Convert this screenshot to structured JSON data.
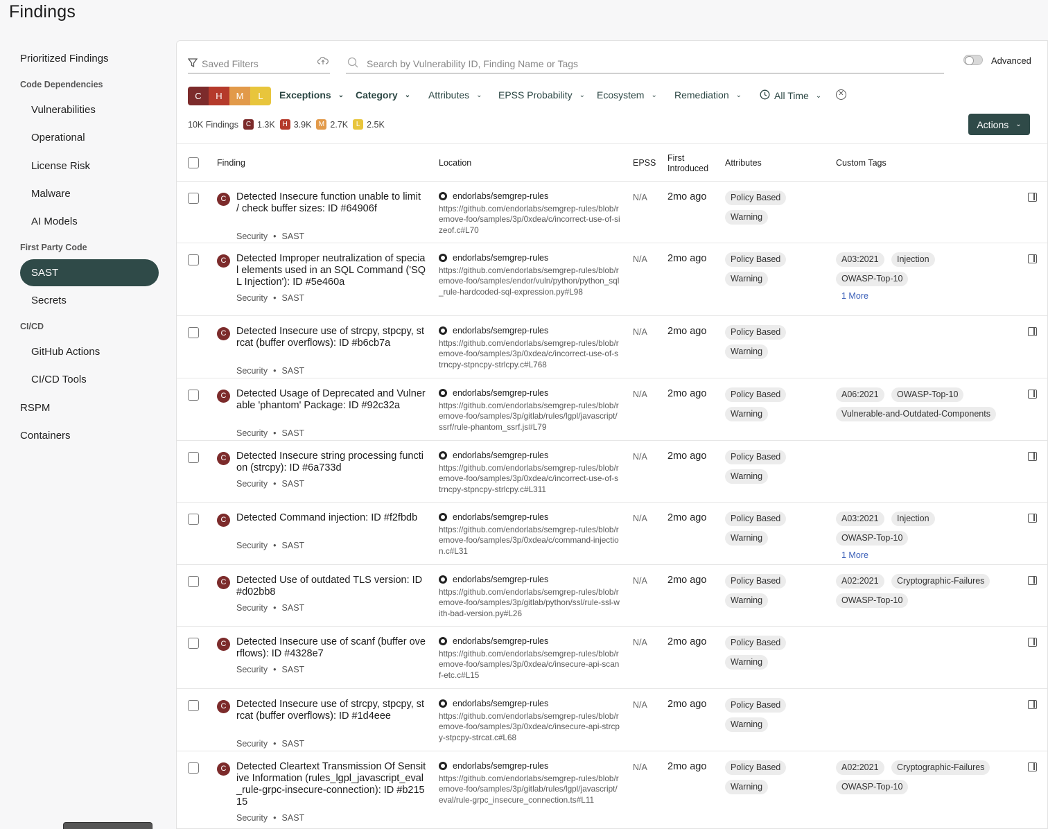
{
  "page": {
    "title": "Findings"
  },
  "sidebar": {
    "prioritized": "Prioritized Findings",
    "code_deps_header": "Code Dependencies",
    "vulnerabilities": "Vulnerabilities",
    "operational": "Operational",
    "license_risk": "License Risk",
    "malware": "Malware",
    "ai_models": "AI Models",
    "first_party_header": "First Party Code",
    "sast": "SAST",
    "secrets": "Secrets",
    "cicd_header": "CI/CD",
    "github_actions": "GitHub Actions",
    "cicd_tools": "CI/CD Tools",
    "rspm": "RSPM",
    "containers": "Containers"
  },
  "toolbar": {
    "saved_filters_placeholder": "Saved Filters",
    "search_placeholder": "Search by Vulnerability ID, Finding Name or Tags",
    "advanced_label": "Advanced",
    "severity_chips": [
      {
        "label": "C",
        "color": "#7c2b2b"
      },
      {
        "label": "H",
        "color": "#b53a2b"
      },
      {
        "label": "M",
        "color": "#e29a4a"
      },
      {
        "label": "L",
        "color": "#e8c53c"
      }
    ],
    "filters": {
      "exceptions": "Exceptions",
      "category": "Category",
      "attributes": "Attributes",
      "epss": "EPSS Probability",
      "ecosystem": "Ecosystem",
      "remediation": "Remediation",
      "time": "All Time"
    },
    "count_label": "10K Findings",
    "counts": {
      "c": "1.3K",
      "h": "3.9K",
      "m": "2.7K",
      "l": "2.5K"
    },
    "actions_label": "Actions"
  },
  "table": {
    "headers": {
      "finding": "Finding",
      "location": "Location",
      "epss": "EPSS",
      "first_introduced_1": "First",
      "first_introduced_2": "Introduced",
      "attributes": "Attributes",
      "custom_tags": "Custom Tags"
    },
    "rows": [
      {
        "severity": "C",
        "title": "Detected Insecure function unable to limit / check buffer sizes: ID #64906f",
        "meta_a": "Security",
        "meta_b": "SAST",
        "repo": "endorlabs/semgrep-rules",
        "url": "https://github.com/endorlabs/semgrep-rules/blob/remove-foo/samples/3p/0xdea/c/incorrect-use-of-sizeof.c#L70",
        "epss": "N/A",
        "introduced": "2mo ago",
        "attr_1": "Policy Based",
        "attr_2": "Warning",
        "tags": [],
        "more": ""
      },
      {
        "severity": "C",
        "title": "Detected Improper neutralization of special elements used in an SQL Command ('SQL Injection'): ID #5e460a",
        "meta_a": "Security",
        "meta_b": "SAST",
        "repo": "endorlabs/semgrep-rules",
        "url": "https://github.com/endorlabs/semgrep-rules/blob/remove-foo/samples/endor/vuln/python/python_sql_rule-hardcoded-sql-expression.py#L98",
        "epss": "N/A",
        "introduced": "2mo ago",
        "attr_1": "Policy Based",
        "attr_2": "Warning",
        "tags": [
          "A03:2021",
          "Injection",
          "OWASP-Top-10"
        ],
        "more": "1 More"
      },
      {
        "severity": "C",
        "title": "Detected Insecure use of strcpy, stpcpy, strcat (buffer overflows): ID #b6cb7a",
        "meta_a": "Security",
        "meta_b": "SAST",
        "repo": "endorlabs/semgrep-rules",
        "url": "https://github.com/endorlabs/semgrep-rules/blob/remove-foo/samples/3p/0xdea/c/incorrect-use-of-strncpy-stpncpy-strlcpy.c#L768",
        "epss": "N/A",
        "introduced": "2mo ago",
        "attr_1": "Policy Based",
        "attr_2": "Warning",
        "tags": [],
        "more": ""
      },
      {
        "severity": "C",
        "title": "Detected Usage of Deprecated and Vulnerable 'phantom' Package: ID #92c32a",
        "meta_a": "Security",
        "meta_b": "SAST",
        "repo": "endorlabs/semgrep-rules",
        "url": "https://github.com/endorlabs/semgrep-rules/blob/remove-foo/samples/3p/gitlab/rules/lgpl/javascript/ssrf/rule-phantom_ssrf.js#L79",
        "epss": "N/A",
        "introduced": "2mo ago",
        "attr_1": "Policy Based",
        "attr_2": "Warning",
        "tags": [
          "A06:2021",
          "OWASP-Top-10",
          "Vulnerable-and-Outdated-Components"
        ],
        "more": ""
      },
      {
        "severity": "C",
        "title": "Detected Insecure string processing function (strcpy): ID #6a733d",
        "meta_a": "Security",
        "meta_b": "SAST",
        "repo": "endorlabs/semgrep-rules",
        "url": "https://github.com/endorlabs/semgrep-rules/blob/remove-foo/samples/3p/0xdea/c/incorrect-use-of-strncpy-stpncpy-strlcpy.c#L311",
        "epss": "N/A",
        "introduced": "2mo ago",
        "attr_1": "Policy Based",
        "attr_2": "Warning",
        "tags": [],
        "more": ""
      },
      {
        "severity": "C",
        "title": "Detected Command injection: ID #f2fbdb",
        "meta_a": "Security",
        "meta_b": "SAST",
        "repo": "endorlabs/semgrep-rules",
        "url": "https://github.com/endorlabs/semgrep-rules/blob/remove-foo/samples/3p/0xdea/c/command-injection.c#L31",
        "epss": "N/A",
        "introduced": "2mo ago",
        "attr_1": "Policy Based",
        "attr_2": "Warning",
        "tags": [
          "A03:2021",
          "Injection",
          "OWASP-Top-10"
        ],
        "more": "1 More"
      },
      {
        "severity": "C",
        "title": "Detected Use of outdated TLS version: ID #d02bb8",
        "meta_a": "Security",
        "meta_b": "SAST",
        "repo": "endorlabs/semgrep-rules",
        "url": "https://github.com/endorlabs/semgrep-rules/blob/remove-foo/samples/3p/gitlab/python/ssl/rule-ssl-with-bad-version.py#L26",
        "epss": "N/A",
        "introduced": "2mo ago",
        "attr_1": "Policy Based",
        "attr_2": "Warning",
        "tags": [
          "A02:2021",
          "Cryptographic-Failures",
          "OWASP-Top-10"
        ],
        "more": ""
      },
      {
        "severity": "C",
        "title": "Detected Insecure use of scanf (buffer overflows): ID #4328e7",
        "meta_a": "Security",
        "meta_b": "SAST",
        "repo": "endorlabs/semgrep-rules",
        "url": "https://github.com/endorlabs/semgrep-rules/blob/remove-foo/samples/3p/0xdea/c/insecure-api-scanf-etc.c#L15",
        "epss": "N/A",
        "introduced": "2mo ago",
        "attr_1": "Policy Based",
        "attr_2": "Warning",
        "tags": [],
        "more": ""
      },
      {
        "severity": "C",
        "title": "Detected Insecure use of strcpy, stpcpy, strcat (buffer overflows): ID #1d4eee",
        "meta_a": "Security",
        "meta_b": "SAST",
        "repo": "endorlabs/semgrep-rules",
        "url": "https://github.com/endorlabs/semgrep-rules/blob/remove-foo/samples/3p/0xdea/c/insecure-api-strcpy-stpcpy-strcat.c#L68",
        "epss": "N/A",
        "introduced": "2mo ago",
        "attr_1": "Policy Based",
        "attr_2": "Warning",
        "tags": [],
        "more": ""
      },
      {
        "severity": "C",
        "title": "Detected Cleartext Transmission Of Sensitive Information (rules_lgpl_javascript_eval_rule-grpc-insecure-connection): ID #b21515",
        "meta_a": "Security",
        "meta_b": "SAST",
        "repo": "endorlabs/semgrep-rules",
        "url": "https://github.com/endorlabs/semgrep-rules/blob/remove-foo/samples/3p/gitlab/rules/lgpl/javascript/eval/rule-grpc_insecure_connection.ts#L11",
        "epss": "N/A",
        "introduced": "2mo ago",
        "attr_1": "Policy Based",
        "attr_2": "Warning",
        "tags": [
          "A02:2021",
          "Cryptographic-Failures",
          "OWASP-Top-10"
        ],
        "more": ""
      }
    ]
  }
}
